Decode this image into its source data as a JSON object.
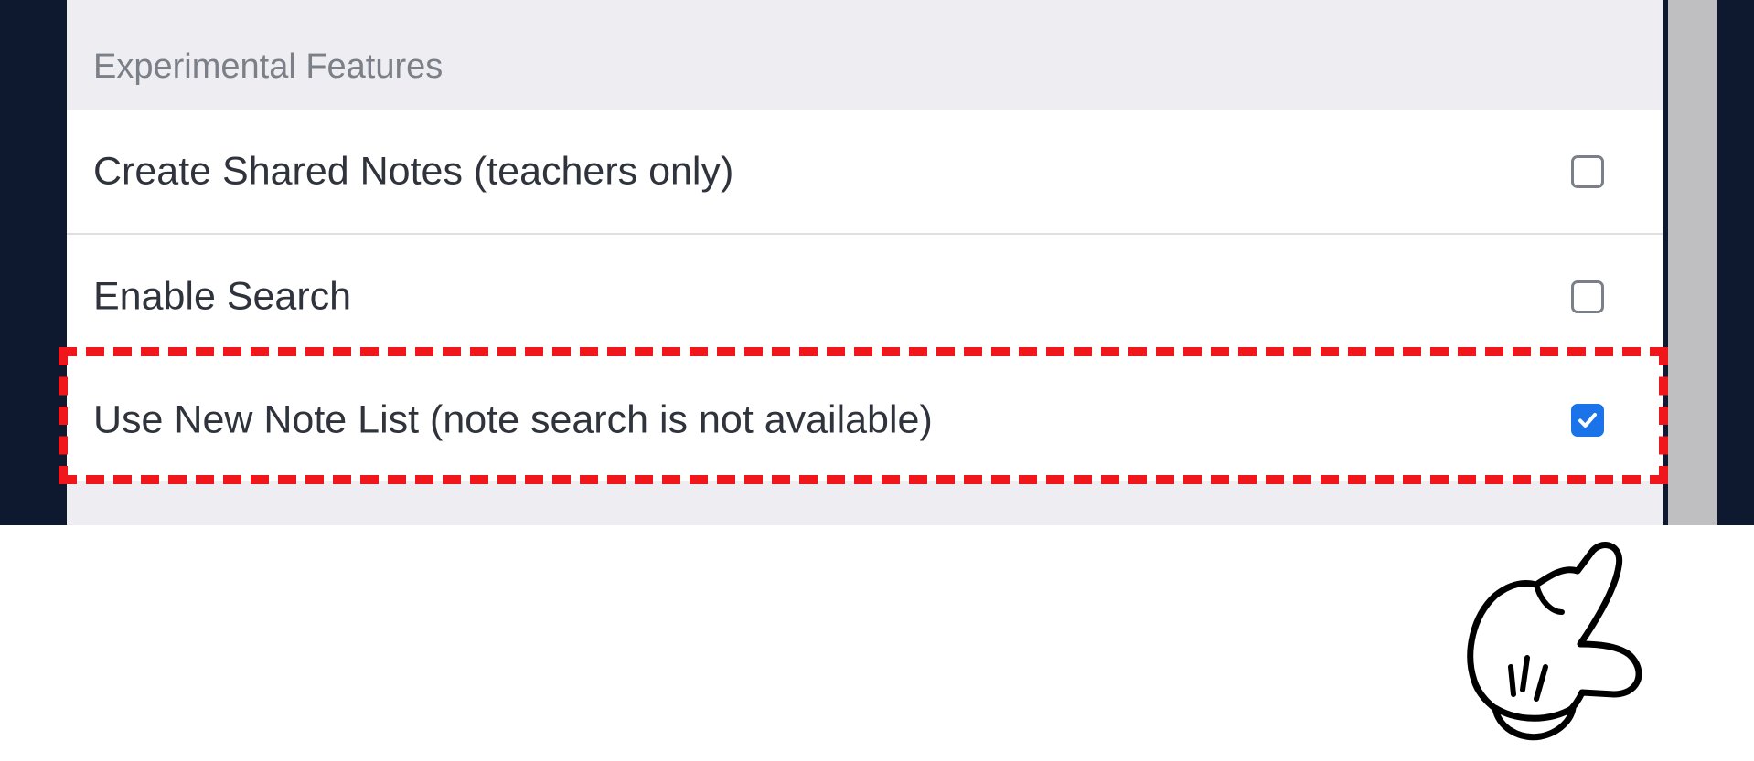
{
  "settings": {
    "section_title": "Experimental Features",
    "options": [
      {
        "label": "Create Shared Notes (teachers only)",
        "checked": false
      },
      {
        "label": "Enable Search",
        "checked": false
      },
      {
        "label": "Use New Note List (note search is not available)",
        "checked": true
      }
    ]
  },
  "colors": {
    "checkbox_accent": "#1a73e8",
    "highlight": "#f0171c",
    "app_background": "#0e1930"
  },
  "icons": {
    "check": "checkmark-icon",
    "pointer": "pointing-hand-icon"
  }
}
